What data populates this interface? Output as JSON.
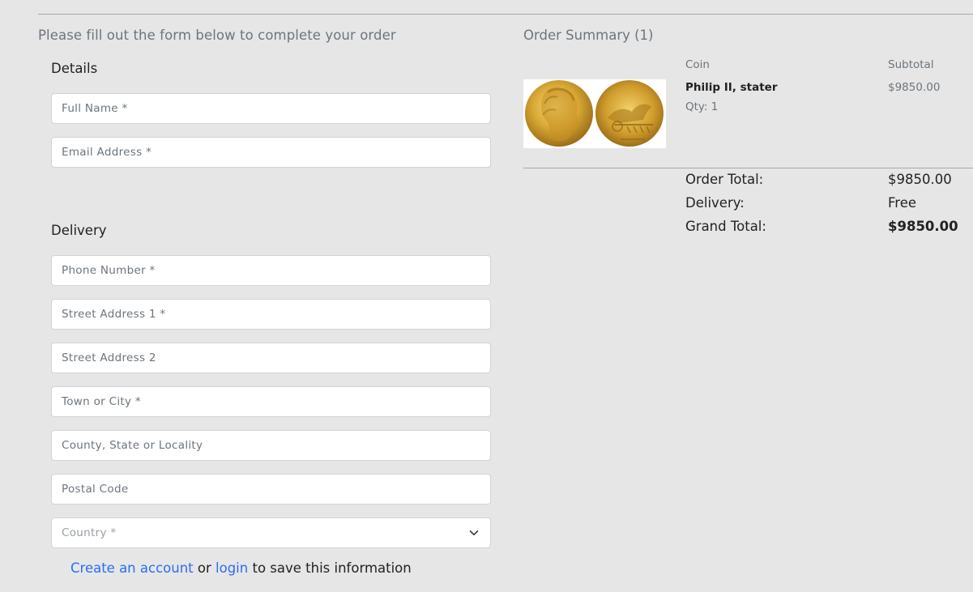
{
  "form": {
    "title": "Please fill out the form below to complete your order",
    "details_heading": "Details",
    "delivery_heading": "Delivery",
    "fields": {
      "full_name": {
        "placeholder": "Full Name *",
        "value": ""
      },
      "email": {
        "placeholder": "Email Address *",
        "value": ""
      },
      "phone": {
        "placeholder": "Phone Number *",
        "value": ""
      },
      "street1": {
        "placeholder": "Street Address 1 *",
        "value": ""
      },
      "street2": {
        "placeholder": "Street Address 2",
        "value": ""
      },
      "town": {
        "placeholder": "Town or City *",
        "value": ""
      },
      "county": {
        "placeholder": "County, State or Locality",
        "value": ""
      },
      "postcode": {
        "placeholder": "Postal Code",
        "value": ""
      },
      "country": {
        "selected": "Country *"
      }
    },
    "save_info": {
      "create_account": "Create an account",
      "or": "or",
      "login": "login",
      "suffix": "to save this information"
    }
  },
  "summary": {
    "title": "Order Summary (1)",
    "col_coin": "Coin",
    "col_subtotal": "Subtotal",
    "item": {
      "name": "Philip II, stater",
      "qty": "Qty: 1",
      "subtotal": "$9850.00"
    },
    "order_total_label": "Order Total:",
    "order_total_value": "$9850.00",
    "delivery_label": "Delivery:",
    "delivery_value": "Free",
    "grand_total_label": "Grand Total:",
    "grand_total_value": "$9850.00"
  },
  "colors": {
    "background": "#e6e6e6",
    "link": "#2a6df4",
    "muted_text": "#6c757d",
    "coin_gold": "#d4a52a"
  },
  "icons": {
    "country_select": "chevron-down-icon",
    "coin_image": "gold-stater-coin-image"
  }
}
